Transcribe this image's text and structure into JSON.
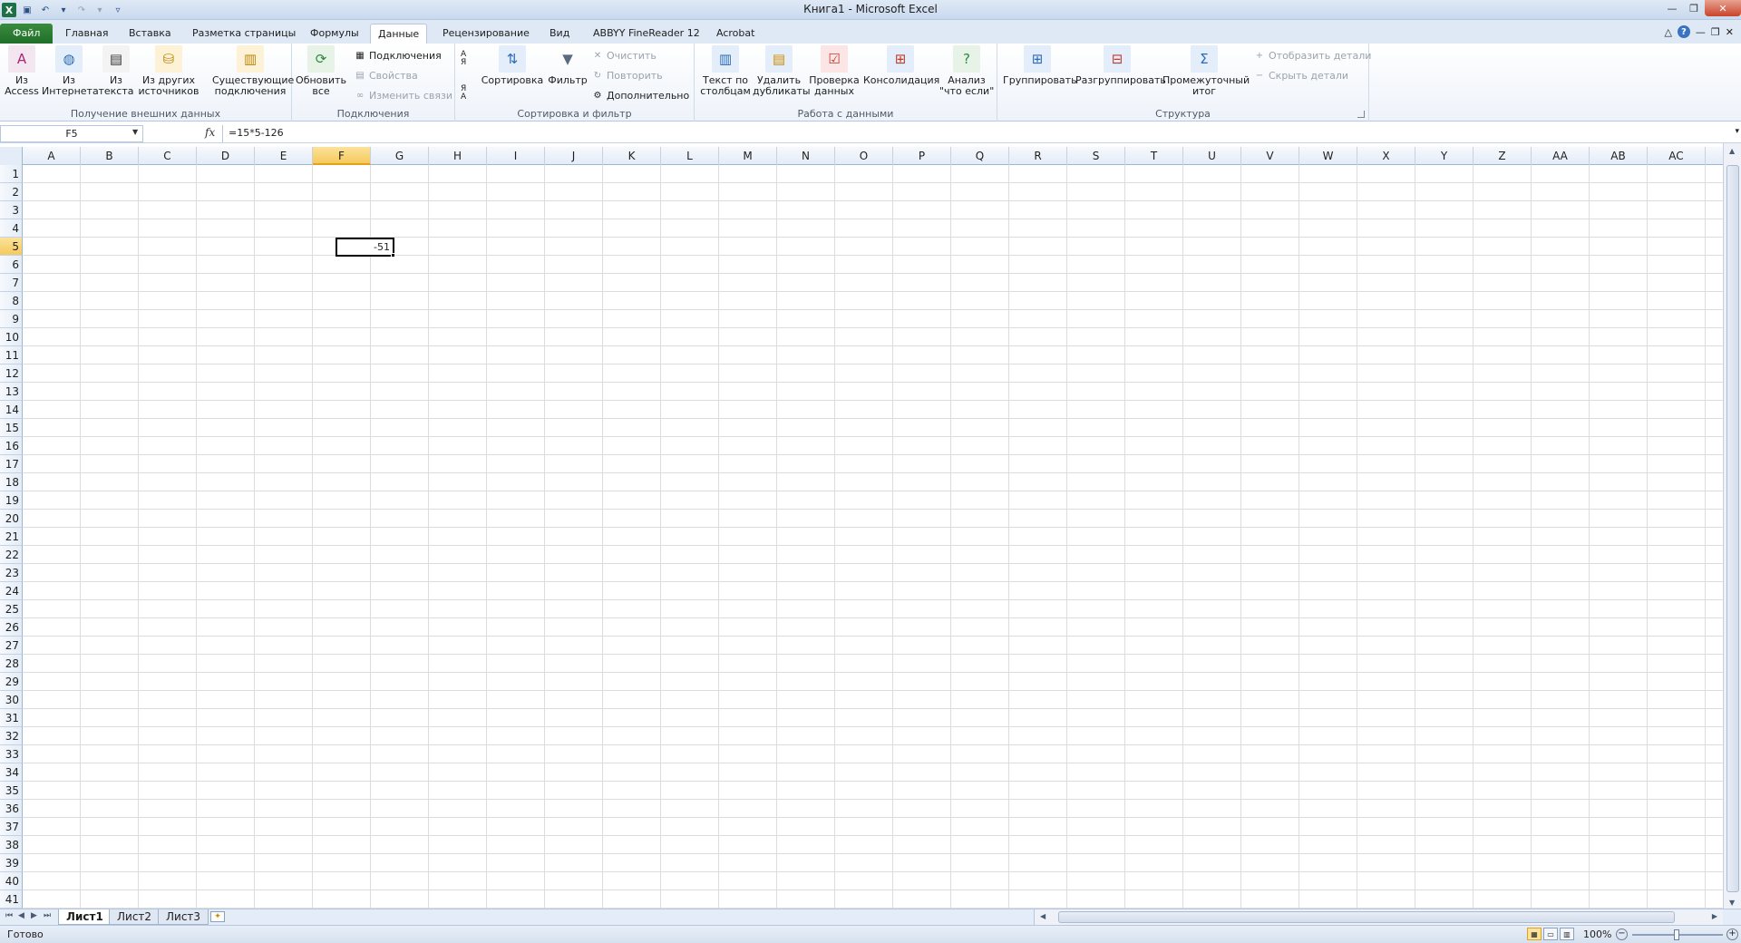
{
  "window": {
    "title": "Книга1  -  Microsoft Excel",
    "app_icon": "X",
    "controls": [
      "minimize-icon",
      "restore-icon",
      "close-icon"
    ]
  },
  "tabs": {
    "file": "Файл",
    "items": [
      "Главная",
      "Вставка",
      "Разметка страницы",
      "Формулы",
      "Данные",
      "Рецензирование",
      "Вид",
      "ABBYY FineReader 12",
      "Acrobat"
    ],
    "active": "Данные"
  },
  "ribbon": {
    "external_data": {
      "label": "Получение внешних данных",
      "from_access": "Из\nAccess",
      "from_web": "Из\nИнтернета",
      "from_text": "Из\nтекста",
      "from_other": "Из других\nисточников",
      "existing": "Существующие\nподключения"
    },
    "connections": {
      "label": "Подключения",
      "refresh_all": "Обновить\nвсе",
      "connections": "Подключения",
      "properties": "Свойства",
      "edit_links": "Изменить связи"
    },
    "sort_filter": {
      "label": "Сортировка и фильтр",
      "sort_az": "А\nЯ",
      "sort_za": "Я\nА",
      "sort": "Сортировка",
      "filter": "Фильтр",
      "clear": "Очистить",
      "reapply": "Повторить",
      "advanced": "Дополнительно"
    },
    "data_tools": {
      "label": "Работа с данными",
      "text_to_columns": "Текст по\nстолбцам",
      "remove_duplicates": "Удалить\nдубликаты",
      "validation": "Проверка\nданных",
      "consolidate": "Консолидация",
      "what_if": "Анализ\n\"что если\""
    },
    "outline": {
      "label": "Структура",
      "group": "Группировать",
      "ungroup": "Разгруппировать",
      "subtotal": "Промежуточный\nитог",
      "show_detail": "Отобразить детали",
      "hide_detail": "Скрыть детали"
    }
  },
  "formula_bar": {
    "name_box": "F5",
    "formula": "=15*5-126"
  },
  "grid": {
    "columns": [
      "A",
      "B",
      "C",
      "D",
      "E",
      "F",
      "G",
      "H",
      "I",
      "J",
      "K",
      "L",
      "M",
      "N",
      "O",
      "P",
      "Q",
      "R",
      "S",
      "T",
      "U",
      "V",
      "W",
      "X",
      "Y",
      "Z",
      "AA",
      "AB",
      "AC"
    ],
    "rows": [
      "1",
      "2",
      "3",
      "4",
      "5",
      "6",
      "7",
      "8",
      "9",
      "10",
      "11",
      "12",
      "13",
      "14",
      "15",
      "16",
      "17",
      "18",
      "19",
      "20",
      "21",
      "22",
      "23",
      "24",
      "25",
      "26",
      "27",
      "28",
      "29",
      "30",
      "31",
      "32",
      "33",
      "34",
      "35",
      "36",
      "37",
      "38",
      "39",
      "40",
      "41"
    ],
    "selected_col": "F",
    "selected_row": "5",
    "active_cell_value": "-51"
  },
  "sheets": {
    "tabs": [
      "Лист1",
      "Лист2",
      "Лист3"
    ],
    "active": "Лист1"
  },
  "status": {
    "ready": "Готово",
    "zoom": "100%"
  },
  "colors": {
    "file_tab": "#1f6f2a",
    "selection_header": "#f6c95c",
    "grid_line": "#dadcdd"
  }
}
